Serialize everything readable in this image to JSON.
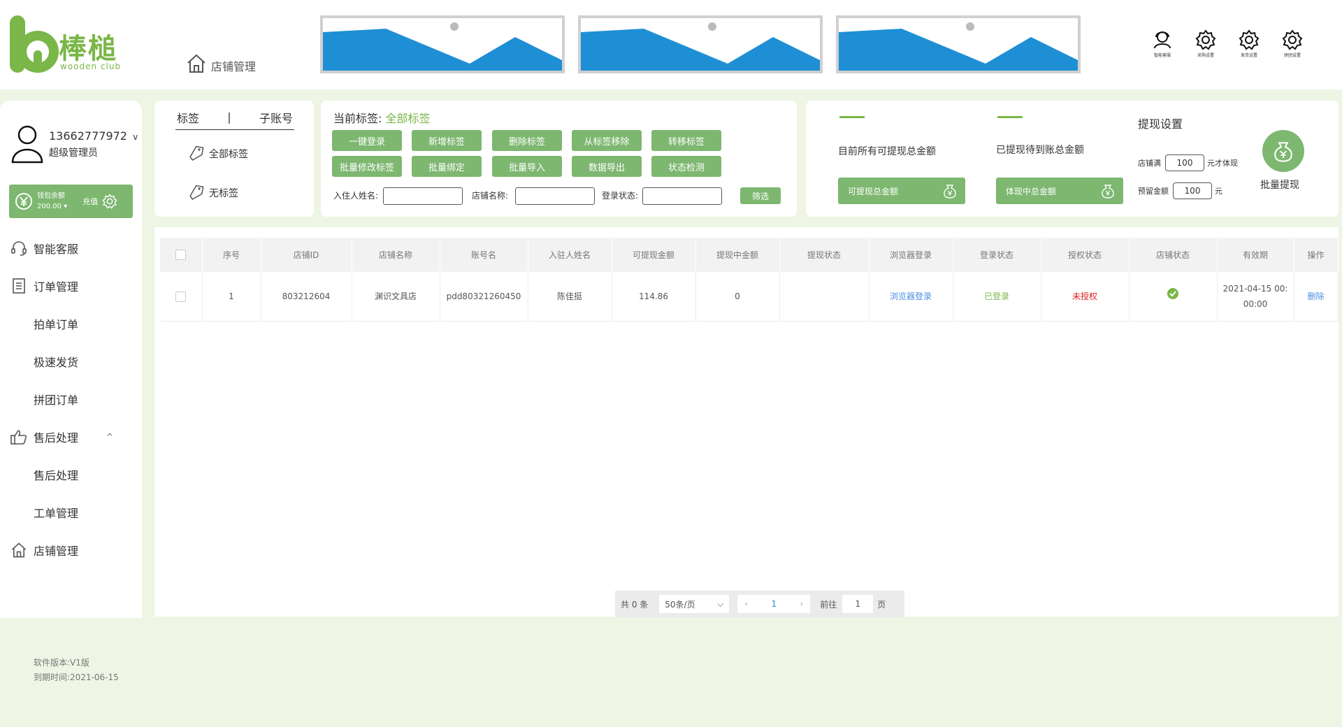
{
  "brand": {
    "name": "棒槌",
    "sub": "wooden club",
    "color": "#7ab648"
  },
  "header": {
    "breadcrumb": "店铺管理",
    "top_icons": [
      {
        "icon": "customer-service-icon",
        "label": "智能客服"
      },
      {
        "icon": "gear-icon",
        "label": "采购设置"
      },
      {
        "icon": "gear-icon",
        "label": "发货设置"
      },
      {
        "icon": "gear-icon",
        "label": "拼团设置"
      }
    ]
  },
  "user": {
    "phone": "13662777972",
    "caret": "v",
    "role": "超级管理员"
  },
  "wallet": {
    "label": "钱包余额",
    "amount": "200.00",
    "charge": "充值"
  },
  "nav": {
    "items": [
      {
        "label": "智能客服"
      },
      {
        "label": "订单管理"
      },
      {
        "label": "拍单订单"
      },
      {
        "label": "极速发货"
      },
      {
        "label": "拼团订单"
      },
      {
        "label": "售后处理",
        "caret": "^"
      },
      {
        "label": "售后处理"
      },
      {
        "label": "工单管理"
      },
      {
        "label": "店铺管理"
      }
    ]
  },
  "tags": {
    "tab_tags": "标签",
    "tab_sep": "|",
    "tab_sub": "子账号",
    "all": "全部标签",
    "none": "无标签"
  },
  "ops": {
    "current_label": "当前标签:",
    "current_value": "全部标签",
    "buttons": [
      "一键登录",
      "新增标签",
      "删除标签",
      "从标签移除",
      "转移标签",
      "批量修改标签",
      "批量绑定",
      "批量导入",
      "数据导出",
      "状态检测"
    ],
    "filters": {
      "name": "入住人姓名:",
      "shop": "店铺名称:",
      "status": "登录状态:",
      "submit": "筛选"
    }
  },
  "funds": {
    "available_dash": "—— ",
    "available_title": "目前所有可提现总金额",
    "available_btn": "可提现总金额",
    "pending_dash": "——",
    "pending_title": "已提现待到账总金额",
    "pending_btn": "体现中总金额",
    "withdraw_title": "提现设置",
    "threshold_label": "店铺满",
    "threshold_value": "100",
    "threshold_suffix": "元才体现",
    "reserve_label": "预留金额",
    "reserve_value": "100",
    "reserve_suffix": "元",
    "batch": "批量提现"
  },
  "table": {
    "headers": [
      "序号",
      "店铺ID",
      "店铺名称",
      "账号名",
      "入驻人姓名",
      "可提现金额",
      "提现中金额",
      "提现状态",
      "浏览器登录",
      "登录状态",
      "授权状态",
      "店铺状态",
      "有效期",
      "操作"
    ],
    "rows": [
      {
        "index": "1",
        "shop_id": "803212604",
        "shop_name": "渊识文具店",
        "account": "pdd80321260450",
        "owner": "陈佳挺",
        "available": "114.86",
        "pending": "0",
        "withdraw_status": "",
        "browser_login": "浏览器登录",
        "login_status": "已登录",
        "auth_status": "未授权",
        "shop_status": "check-circle-icon",
        "expiry": "2021-04-15 00:00:00",
        "action": "删除"
      }
    ]
  },
  "pagination": {
    "total": "共 0 条",
    "page_size": "50条/页",
    "current": "1",
    "goto_label": "前往",
    "goto_value": "1",
    "goto_suffix": "页"
  },
  "footer": {
    "version": "软件版本:V1版",
    "expire": "到期时间:2021-06-15"
  }
}
